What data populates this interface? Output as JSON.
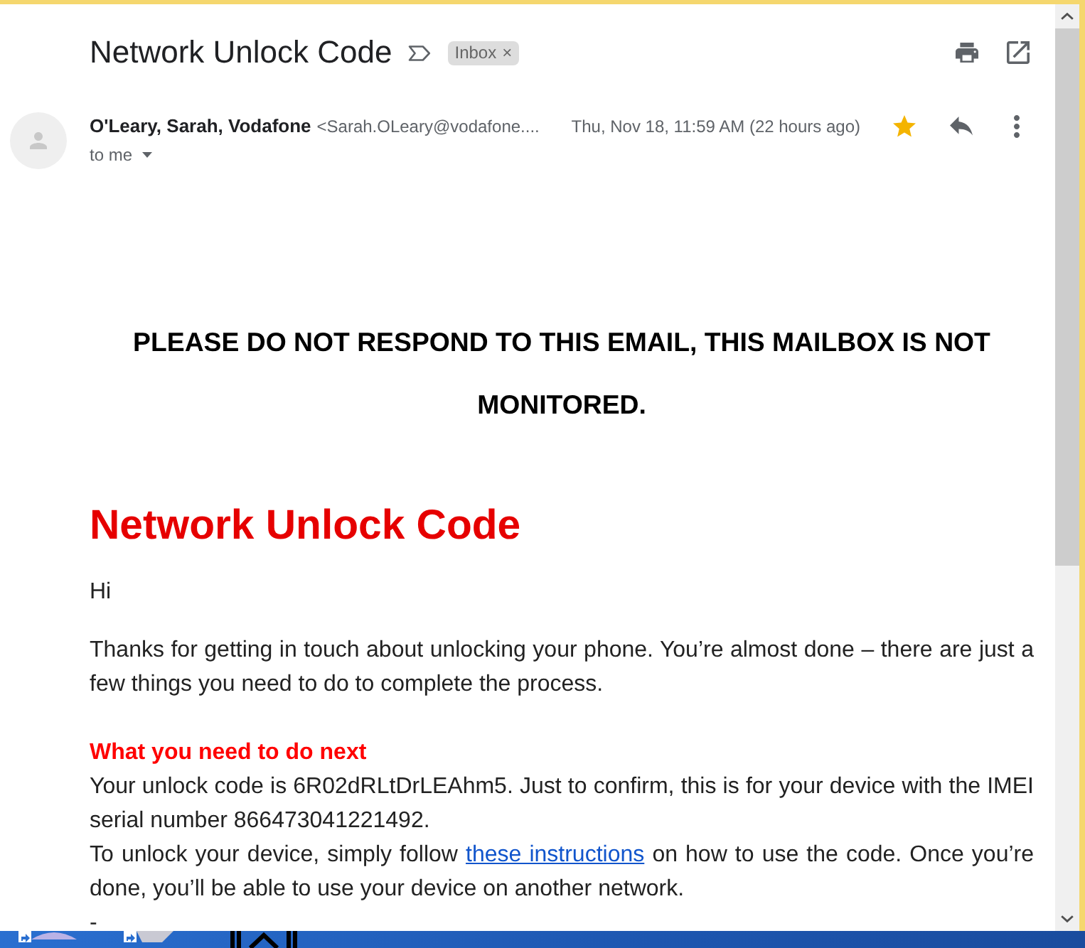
{
  "email": {
    "subject": "Network Unlock Code",
    "labels": [
      {
        "text": "Inbox",
        "remove": "×"
      }
    ],
    "sender": {
      "name": "O'Leary, Sarah, Vodafone",
      "address": "<Sarah.OLeary@vodafone....",
      "date": "Thu, Nov 18, 11:59 AM (22 hours ago)",
      "recipient": "to me",
      "starred": true
    },
    "body": [
      {
        "kind": "notice",
        "text": "PLEASE DO NOT RESPOND TO THIS EMAIL, THIS MAILBOX IS NOT MONITORED."
      },
      {
        "kind": "title",
        "text": "Network Unlock Code"
      },
      {
        "kind": "paragraph",
        "text": "Hi"
      },
      {
        "kind": "paragraph",
        "text": "Thanks for getting in touch about unlocking your phone. You’re almost done – there are just a few things you need to do to complete the process."
      },
      {
        "kind": "subheading",
        "text": "What you need to do next"
      },
      {
        "kind": "line",
        "text": "Your unlock code is 6R02dRLtDrLEAhm5. Just to confirm, this is for your device with the IMEI serial number 866473041221492."
      },
      {
        "kind": "line",
        "text": "To unlock your device, simply follow",
        "link": "these instructions",
        "after": "on how to use the code. Once you’re done, you’ll be able to use your device on another network."
      },
      {
        "kind": "cut_line",
        "text": "-"
      }
    ]
  }
}
